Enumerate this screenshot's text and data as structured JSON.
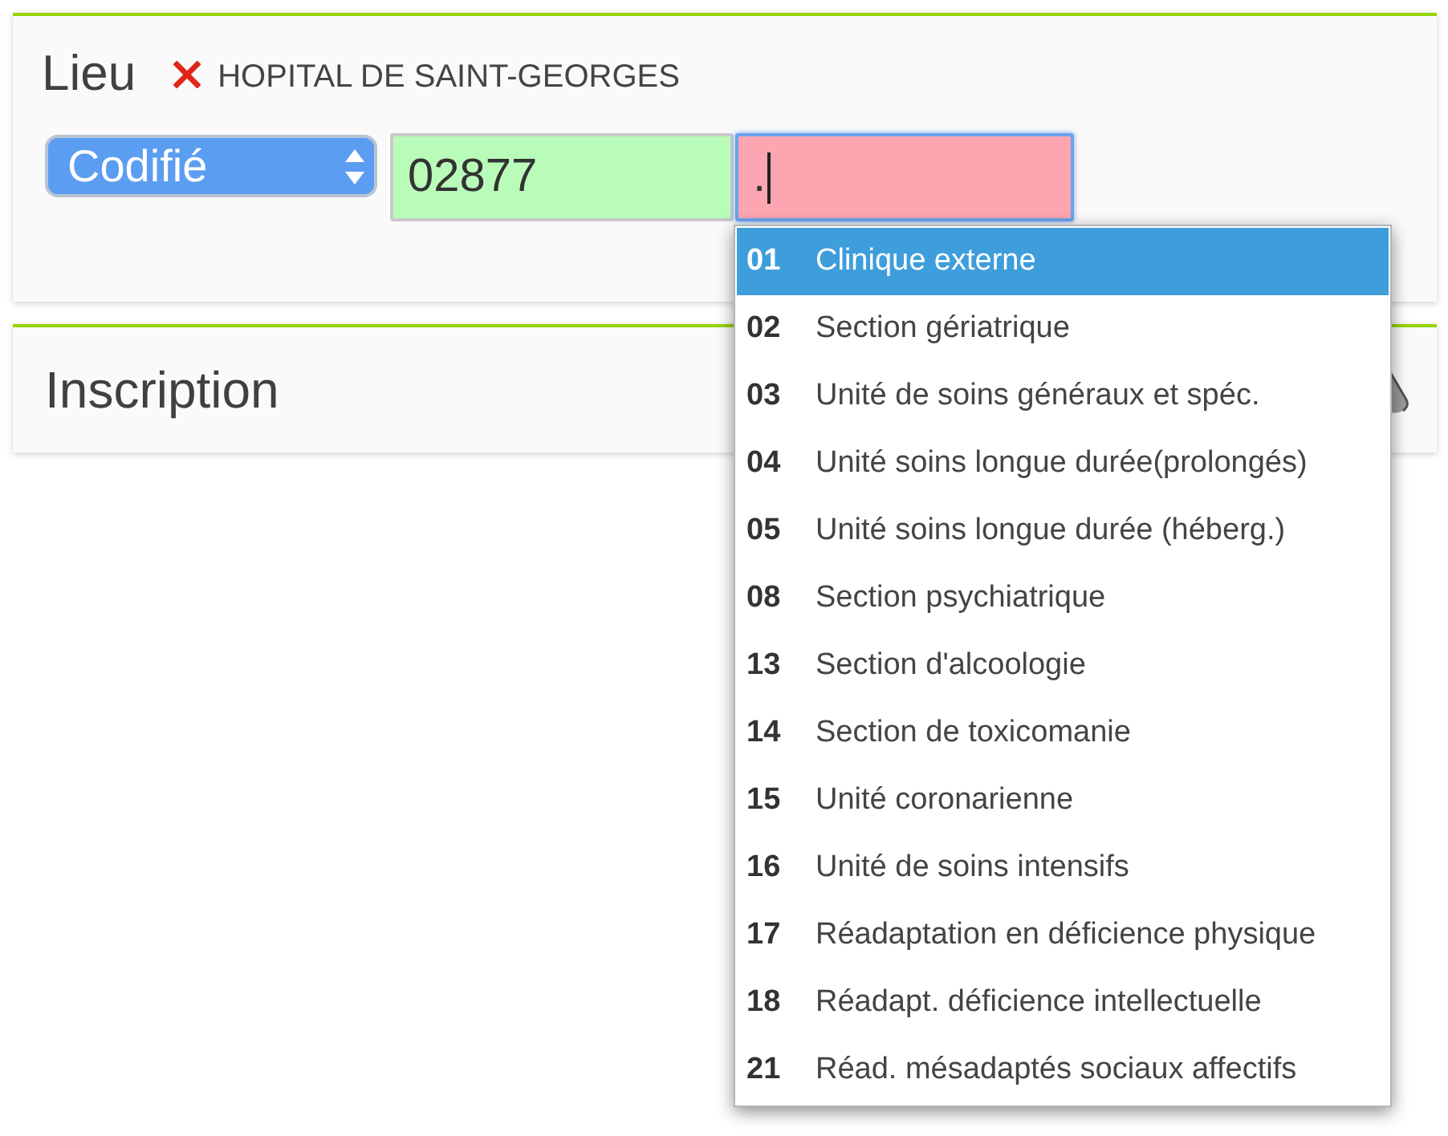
{
  "location": {
    "title": "Lieu",
    "name": "HOPITAL DE SAINT-GEORGES",
    "type_select": {
      "value": "Codifié"
    },
    "code_field": {
      "value": "02877",
      "valid": true,
      "focused": false
    },
    "subcode_field": {
      "value": ".",
      "valid": false,
      "focused": true
    },
    "suggestions": [
      {
        "code": "01",
        "label": "Clinique externe",
        "selected": true
      },
      {
        "code": "02",
        "label": "Section gériatrique",
        "selected": false
      },
      {
        "code": "03",
        "label": "Unité de soins généraux et spéc.",
        "selected": false
      },
      {
        "code": "04",
        "label": "Unité soins longue durée(prolongés)",
        "selected": false
      },
      {
        "code": "05",
        "label": "Unité soins longue durée (héberg.)",
        "selected": false
      },
      {
        "code": "08",
        "label": "Section psychiatrique",
        "selected": false
      },
      {
        "code": "13",
        "label": "Section d'alcoologie",
        "selected": false
      },
      {
        "code": "14",
        "label": "Section de toxicomanie",
        "selected": false
      },
      {
        "code": "15",
        "label": "Unité coronarienne",
        "selected": false
      },
      {
        "code": "16",
        "label": "Unité de soins intensifs",
        "selected": false
      },
      {
        "code": "17",
        "label": "Réadaptation en déficience physique",
        "selected": false
      },
      {
        "code": "18",
        "label": "Réadapt. déficience intellectuelle",
        "selected": false
      },
      {
        "code": "21",
        "label": "Réad. mésadaptés sociaux affectifs",
        "selected": false
      }
    ]
  },
  "inscription": {
    "title": "Inscription"
  }
}
